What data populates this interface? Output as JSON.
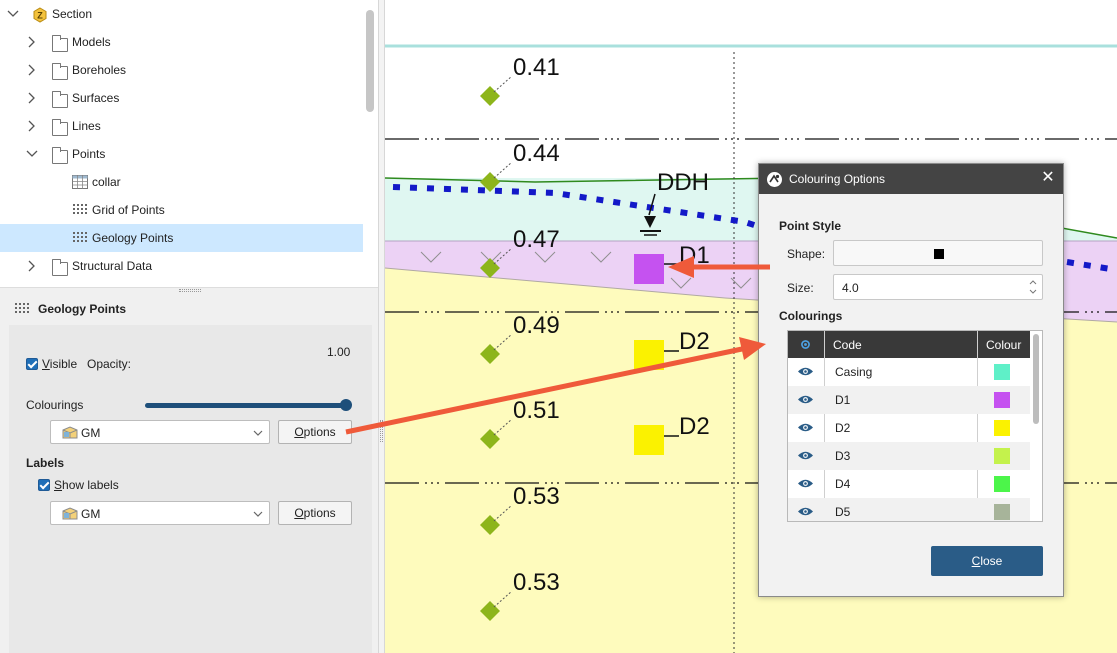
{
  "tree": {
    "root_label": "Section",
    "items": [
      {
        "label": "Models",
        "icon": "folder-icon"
      },
      {
        "label": "Boreholes",
        "icon": "folder-icon"
      },
      {
        "label": "Surfaces",
        "icon": "folder-icon"
      },
      {
        "label": "Lines",
        "icon": "folder-icon"
      },
      {
        "label": "Points",
        "icon": "folder-icon",
        "expanded": true
      },
      {
        "label": "collar",
        "icon": "table-icon"
      },
      {
        "label": "Grid of Points",
        "icon": "points-grid-icon"
      },
      {
        "label": "Geology Points",
        "icon": "points-grid-icon",
        "selected": true
      },
      {
        "label": "Structural Data",
        "icon": "folder-icon"
      }
    ]
  },
  "properties": {
    "title": "Geology Points",
    "visible_label": "Visible",
    "opacity_label": "Opacity:",
    "opacity_value": "1.00",
    "opacity_fraction": 1.0,
    "colourings_label": "Colourings",
    "colouring_selected": "GM",
    "options_label": "Options",
    "labels_label": "Labels",
    "show_labels_label": "Show labels",
    "label_selected": "GM",
    "options_label_2": "Options"
  },
  "scene": {
    "values": [
      "0.41",
      "0.44",
      "0.47",
      "0.49",
      "0.51",
      "0.53",
      "0.53"
    ],
    "ddh_label": "DDH",
    "tags": [
      "D1",
      "D2",
      "D2"
    ],
    "colors": {
      "turquoise_layer": "#dff7f1",
      "purple_layer": "#ecd2f5",
      "yellow_layer": "#fefbbd",
      "marker": "#8db51b",
      "d1": "#c552f0",
      "d2": "#fbf200",
      "arrow": "#ef5a3a",
      "dotted_line": "#1319c8"
    }
  },
  "dialog": {
    "title": "Colouring Options",
    "point_style_label": "Point Style",
    "shape_label": "Shape:",
    "size_label": "Size:",
    "size_value": "4.0",
    "colourings_label": "Colourings",
    "col_code": "Code",
    "col_colour": "Colour",
    "codes": [
      {
        "code": "Casing",
        "colour": "#5ff0c8"
      },
      {
        "code": "D1",
        "colour": "#c552f0"
      },
      {
        "code": "D2",
        "colour": "#fbf200"
      },
      {
        "code": "D3",
        "colour": "#c4f24c"
      },
      {
        "code": "D4",
        "colour": "#4cf54a"
      },
      {
        "code": "D5",
        "colour": "#a7b49a"
      }
    ],
    "close_label": "Close"
  }
}
